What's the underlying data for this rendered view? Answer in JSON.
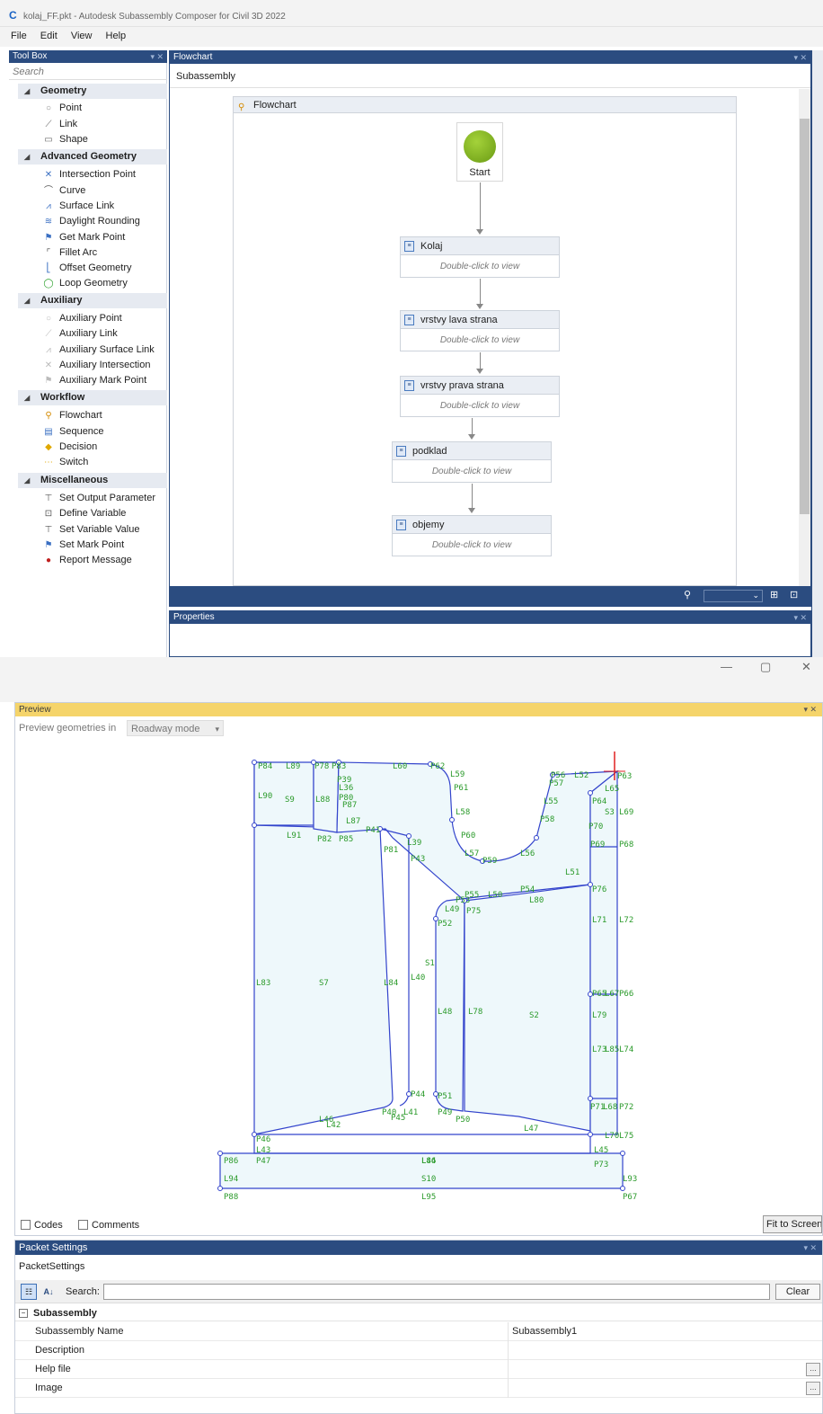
{
  "window": {
    "title": "kolaj_FF.pkt - Autodesk Subassembly Composer for Civil 3D 2022",
    "menu": [
      "File",
      "Edit",
      "View",
      "Help"
    ]
  },
  "toolbox": {
    "title": "Tool Box",
    "search_placeholder": "Search",
    "categories": [
      {
        "label": "Geometry",
        "items": [
          "Point",
          "Link",
          "Shape"
        ]
      },
      {
        "label": "Advanced Geometry",
        "items": [
          "Intersection Point",
          "Curve",
          "Surface Link",
          "Daylight Rounding",
          "Get Mark Point",
          "Fillet Arc",
          "Offset Geometry",
          "Loop Geometry"
        ]
      },
      {
        "label": "Auxiliary",
        "items": [
          "Auxiliary Point",
          "Auxiliary Link",
          "Auxiliary Surface Link",
          "Auxiliary Intersection",
          "Auxiliary Mark Point"
        ]
      },
      {
        "label": "Workflow",
        "items": [
          "Flowchart",
          "Sequence",
          "Decision",
          "Switch"
        ]
      },
      {
        "label": "Miscellaneous",
        "items": [
          "Set Output Parameter",
          "Define Variable",
          "Set Variable Value",
          "Set Mark Point",
          "Report Message"
        ]
      }
    ]
  },
  "flowchart": {
    "panel_title": "Flowchart",
    "subtitle": "Subassembly",
    "frame_title": "Flowchart",
    "start_label": "Start",
    "activities": [
      {
        "title": "Kolaj",
        "hint": "Double-click to view"
      },
      {
        "title": "vrstvy lava strana",
        "hint": "Double-click to view"
      },
      {
        "title": "vrstvy prava strana",
        "hint": "Double-click to view"
      },
      {
        "title": "podklad",
        "hint": "Double-click to view"
      },
      {
        "title": "objemy",
        "hint": "Double-click to view"
      }
    ]
  },
  "properties": {
    "title": "Properties"
  },
  "preview": {
    "title": "Preview",
    "mode_label": "Preview geometries in",
    "mode_value": "Roadway mode",
    "codes_label": "Codes",
    "comments_label": "Comments",
    "fit_label": "Fit to Screen",
    "labels": [
      "P84",
      "L89",
      "P78",
      "P83",
      "P39",
      "L36",
      "P80",
      "P87",
      "L90",
      "S9",
      "L88",
      "L60",
      "P62",
      "L59",
      "P61",
      "L58",
      "P60",
      "L57",
      "P59",
      "L56",
      "L55",
      "P58",
      "L51",
      "L52",
      "P56",
      "P57",
      "L65",
      "P63",
      "P64",
      "S3",
      "L69",
      "P70",
      "P68",
      "P69",
      "L91",
      "P82",
      "P85",
      "L87",
      "P41",
      "L39",
      "P81",
      "P43",
      "L50",
      "P54",
      "L80",
      "P53",
      "P55",
      "P76",
      "L49",
      "P75",
      "P52",
      "L71",
      "L84",
      "L72",
      "L83",
      "S7",
      "S1",
      "L40",
      "P65",
      "L67",
      "P66",
      "L48",
      "L78",
      "S2",
      "L79",
      "L73",
      "L85",
      "L74",
      "P44",
      "P51",
      "P71",
      "L68",
      "P72",
      "L41",
      "P45",
      "P40",
      "L42",
      "L46",
      "P50",
      "L47",
      "P49",
      "L70",
      "L75",
      "P46",
      "L43",
      "P47",
      "L44",
      "L45",
      "P86",
      "L86",
      "P73",
      "L94",
      "S10",
      "L93",
      "P88",
      "L95",
      "P67"
    ]
  },
  "packet": {
    "title": "Packet Settings",
    "name": "PacketSettings",
    "search_label": "Search:",
    "clear_label": "Clear",
    "section": "Subassembly",
    "rows": [
      {
        "key": "Subassembly Name",
        "value": "Subassembly1"
      },
      {
        "key": "Description",
        "value": ""
      },
      {
        "key": "Help file",
        "value": ""
      },
      {
        "key": "Image",
        "value": ""
      }
    ]
  },
  "colors": {
    "panel_header": "#2b4c80",
    "preview_header": "#f5d46a",
    "geometry_line": "#3344cc",
    "geometry_fill": "#eef8fb",
    "label_green": "#2a9a2a"
  }
}
